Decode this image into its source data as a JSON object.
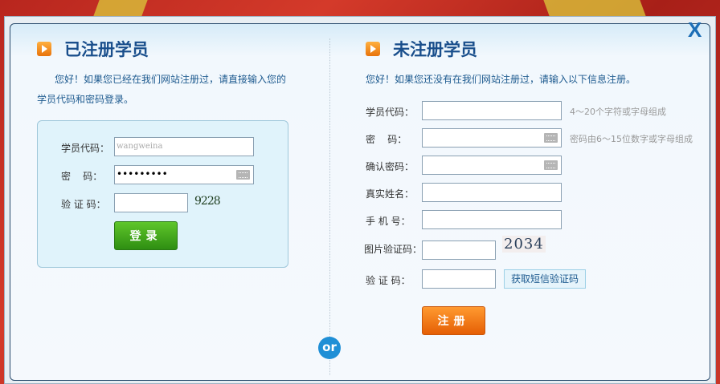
{
  "close_label": "X",
  "login": {
    "title": "已注册学员",
    "intro_line1": "您好！如果您已经在我们网站注册过，请直接输入您的",
    "intro_line2": "学员代码和密码登录。",
    "fields": {
      "user_label": "学员代码：",
      "user_value": "wangweina",
      "password_label": "密    码：",
      "password_value": "•••••••••",
      "captcha_label": "验 证 码：",
      "captcha_text": "9228"
    },
    "submit": "登录"
  },
  "register": {
    "title": "未注册学员",
    "intro": "您好！如果您还没有在我们网站注册过，请输入以下信息注册。",
    "fields": {
      "user_label": "学员代码：",
      "user_hint": "4～20个字符或字母组成",
      "password_label": "密    码：",
      "password_hint": "密码由6～15位数字或字母组成",
      "confirm_label": "确认密码：",
      "name_label": "真实姓名：",
      "phone_label": "手 机 号：",
      "img_captcha_label": "图片验证码：",
      "img_captcha_text": "2034",
      "sms_label": "验 证 码：",
      "sms_button": "获取短信验证码"
    },
    "submit": "注册"
  },
  "or_label": "or"
}
